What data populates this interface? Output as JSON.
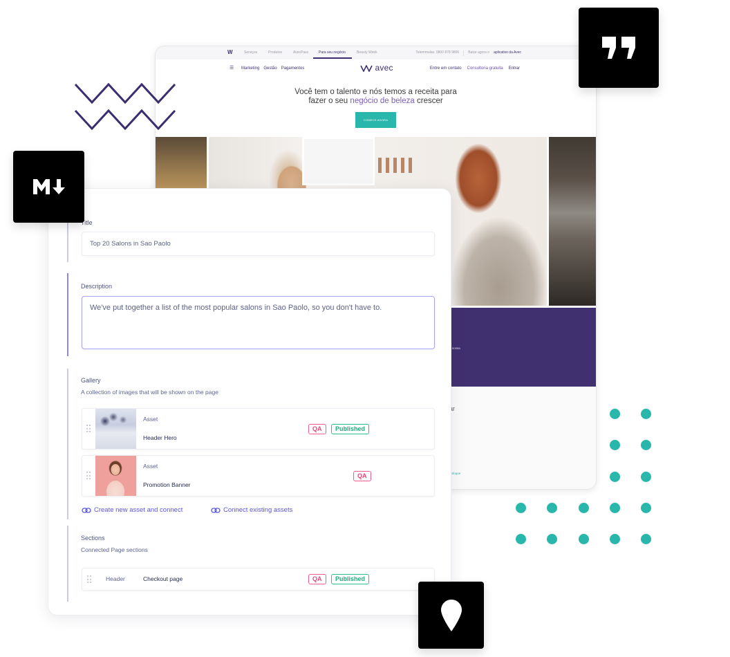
{
  "website_preview": {
    "topbar": {
      "logo": "W",
      "items": [
        "Serviços",
        "Produtos",
        "AvecPass",
        "Para seu negócio",
        "Beauty Week"
      ],
      "active_item": "Para seu negócio",
      "phone": "Telemmulas: 0800 878 9806",
      "download_prefix": "Baixe agora o",
      "download_link": "aplicativo da Avec"
    },
    "mainnav": {
      "menu_icon": "hamburger-icon",
      "left_items": [
        "Marketing",
        "Gestão",
        "Pagamentos"
      ],
      "logo": "avec",
      "right_items": [
        "Entre em contato",
        "Consultoria gratuita",
        "Entrar"
      ]
    },
    "hero": {
      "line1": "Você tem o talento e nós temos a receita para",
      "line2_prefix": "fazer o seu",
      "line2_accent": "negócio de beleza",
      "line2_suffix": "crescer",
      "cta": "COMECE AGORA"
    },
    "purple_band_text": "a nossa",
    "lower_heading_fragment": "ar",
    "lower_link_fragment": "enfoque"
  },
  "decorations": {
    "markdown_badge": "markdown-icon",
    "quote_badge": "quote-icon",
    "location_badge": "location-pin-icon",
    "accent_purple": "#41306f",
    "accent_teal": "#2ab7ab"
  },
  "cms_form": {
    "title_field": {
      "label": "Title",
      "value": "Top 20 Salons in Sao Paolo"
    },
    "description_field": {
      "label": "Description",
      "value": "We've put together a list of the most popular salons in Sao Paolo, so you don't have to."
    },
    "gallery": {
      "label": "Gallery",
      "help": "A collection of images that will be shown on the page",
      "assets": [
        {
          "kind": "Asset",
          "name": "Header Hero",
          "tags": [
            "QA",
            "Published"
          ]
        },
        {
          "kind": "Asset",
          "name": "Promotion Banner",
          "tags": [
            "QA"
          ]
        }
      ],
      "create_link": "Create new asset and connect",
      "connect_link": "Connect existing assets"
    },
    "sections": {
      "label": "Sections",
      "help": "Connected Page sections",
      "rows": [
        {
          "type": "Header",
          "name": "Checkout page",
          "tags": [
            "QA",
            "Published"
          ]
        }
      ]
    },
    "colors": {
      "qa": "#e8467a",
      "published": "#1fae7c",
      "link": "#5a55d6",
      "focus": "#a8a2f6"
    }
  }
}
